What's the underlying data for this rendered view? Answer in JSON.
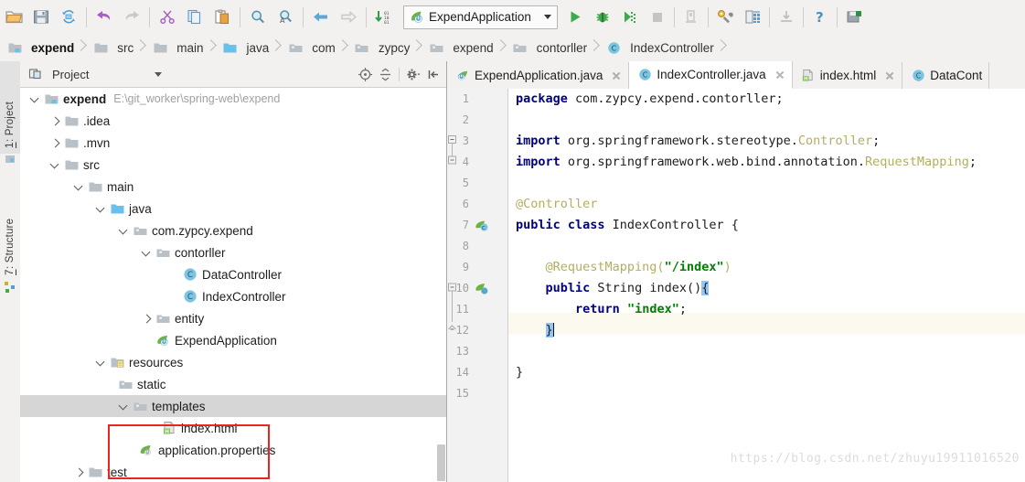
{
  "toolbar": {
    "buttons": [
      {
        "name": "open-folder-icon",
        "label": "Open"
      },
      {
        "name": "save-all-icon",
        "label": "Save All"
      },
      {
        "name": "synchronize-icon",
        "label": "Synchronize"
      },
      {
        "name": "undo-icon",
        "label": "Undo"
      },
      {
        "name": "redo-icon",
        "label": "Redo"
      },
      {
        "name": "cut-icon",
        "label": "Cut"
      },
      {
        "name": "copy-icon",
        "label": "Copy"
      },
      {
        "name": "paste-icon",
        "label": "Paste"
      },
      {
        "name": "find-icon",
        "label": "Find"
      },
      {
        "name": "replace-icon",
        "label": "Replace"
      },
      {
        "name": "back-icon",
        "label": "Back"
      },
      {
        "name": "forward-icon",
        "label": "Forward"
      },
      {
        "name": "compile-icon",
        "label": "Compile"
      }
    ],
    "run_config": {
      "name": "ExpendApplication",
      "icon": "spring-boot-icon"
    },
    "run_buttons": [
      {
        "name": "run-icon",
        "label": "Run"
      },
      {
        "name": "debug-icon",
        "label": "Debug"
      },
      {
        "name": "run-with-coverage-icon",
        "label": "Run with Coverage"
      },
      {
        "name": "stop-icon",
        "label": "Stop"
      },
      {
        "name": "update-application-icon",
        "label": "Update Application"
      },
      {
        "name": "settings-wrench-icon",
        "label": "Project Structure"
      },
      {
        "name": "database-icon",
        "label": "Database"
      },
      {
        "name": "import-icon",
        "label": "Import"
      },
      {
        "name": "help-icon",
        "label": "Help"
      },
      {
        "name": "maven-icon",
        "label": "Maven"
      }
    ]
  },
  "breadcrumb": [
    {
      "label": "expend",
      "icon": "module-folder-icon",
      "root": true
    },
    {
      "label": "src",
      "icon": "folder-icon",
      "root": false
    },
    {
      "label": "main",
      "icon": "folder-icon",
      "root": false
    },
    {
      "label": "java",
      "icon": "source-folder-icon",
      "root": false
    },
    {
      "label": "com",
      "icon": "package-icon",
      "root": false
    },
    {
      "label": "zypcy",
      "icon": "package-icon",
      "root": false
    },
    {
      "label": "expend",
      "icon": "package-icon",
      "root": false
    },
    {
      "label": "contorller",
      "icon": "package-icon",
      "root": false
    },
    {
      "label": "IndexController",
      "icon": "class-icon",
      "root": false
    }
  ],
  "tool_window_tabs": [
    {
      "num": "1",
      "label": ": Project",
      "active": true,
      "icon": "project-icon"
    },
    {
      "num": "7",
      "label": ": Structure",
      "active": false,
      "icon": "structure-icon"
    }
  ],
  "project_panel": {
    "title": "Project",
    "tools": [
      {
        "name": "scroll-from-source-icon"
      },
      {
        "name": "collapse-all-icon"
      },
      {
        "name": "settings-gear-icon"
      },
      {
        "name": "hide-panel-icon"
      }
    ],
    "tree": [
      {
        "depth": 0,
        "twisty": "open",
        "icon": "module-folder-icon",
        "label": "expend",
        "bold": true,
        "path": "E:\\git_worker\\spring-web\\expend",
        "selected": false
      },
      {
        "depth": 1,
        "twisty": "closed",
        "icon": "folder-icon",
        "label": ".idea",
        "bold": false,
        "path": "",
        "selected": false
      },
      {
        "depth": 1,
        "twisty": "closed",
        "icon": "folder-icon",
        "label": ".mvn",
        "bold": false,
        "path": "",
        "selected": false
      },
      {
        "depth": 1,
        "twisty": "open",
        "icon": "folder-icon",
        "label": "src",
        "bold": false,
        "path": "",
        "selected": false
      },
      {
        "depth": 2,
        "twisty": "open",
        "icon": "folder-icon",
        "label": "main",
        "bold": false,
        "path": "",
        "selected": false
      },
      {
        "depth": 3,
        "twisty": "open",
        "icon": "source-folder-icon",
        "label": "java",
        "bold": false,
        "path": "",
        "selected": false
      },
      {
        "depth": 4,
        "twisty": "open",
        "icon": "package-icon",
        "label": "com.zypcy.expend",
        "bold": false,
        "path": "",
        "selected": false
      },
      {
        "depth": 5,
        "twisty": "open",
        "icon": "package-icon",
        "label": "contorller",
        "bold": false,
        "path": "",
        "selected": false
      },
      {
        "depth": 6,
        "twisty": "none",
        "icon": "class-icon",
        "label": "DataController",
        "bold": false,
        "path": "",
        "selected": false
      },
      {
        "depth": 6,
        "twisty": "none",
        "icon": "class-icon",
        "label": "IndexController",
        "bold": false,
        "path": "",
        "selected": false
      },
      {
        "depth": 5,
        "twisty": "closed",
        "icon": "package-icon",
        "label": "entity",
        "bold": false,
        "path": "",
        "selected": false
      },
      {
        "depth": 5,
        "twisty": "none",
        "icon": "spring-boot-icon",
        "label": "ExpendApplication",
        "bold": false,
        "path": "",
        "selected": false
      },
      {
        "depth": 3,
        "twisty": "open",
        "icon": "resources-folder-icon",
        "label": "resources",
        "bold": false,
        "path": "",
        "selected": false
      },
      {
        "depth": 4,
        "twisty": "none",
        "icon": "package-icon",
        "label": "static",
        "bold": false,
        "path": "",
        "selected": false
      },
      {
        "depth": 4,
        "twisty": "open",
        "icon": "package-icon",
        "label": "templates",
        "bold": false,
        "path": "",
        "selected": true
      },
      {
        "depth": 5,
        "twisty": "none",
        "icon": "html-file-icon",
        "label": "index.html",
        "bold": false,
        "path": "",
        "selected": false
      },
      {
        "depth": 4,
        "twisty": "none",
        "icon": "spring-properties-icon",
        "label": "application.properties",
        "bold": false,
        "path": "",
        "selected": false
      },
      {
        "depth": 2,
        "twisty": "closed",
        "icon": "folder-icon",
        "label": "test",
        "bold": false,
        "path": "",
        "selected": false
      }
    ],
    "annotation_color": "#e8251f"
  },
  "editor": {
    "tabs": [
      {
        "label": "ExpendApplication.java",
        "icon": "spring-boot-icon",
        "active": false
      },
      {
        "label": "IndexController.java",
        "icon": "class-icon",
        "active": true
      },
      {
        "label": "index.html",
        "icon": "html-file-icon",
        "active": false
      },
      {
        "label": "DataCont",
        "icon": "class-icon",
        "active": false
      }
    ],
    "line_numbers": [
      "1",
      "2",
      "3",
      "4",
      "5",
      "6",
      "7",
      "8",
      "9",
      "10",
      "11",
      "12",
      "13",
      "14",
      "15"
    ],
    "current_line": 12,
    "caret_line": 12,
    "watermark": "https://blog.csdn.net/zhuyu19911016520",
    "code": [
      {
        "n": 1,
        "text": "package com.zypcy.expend.contorller;"
      },
      {
        "n": 2,
        "text": ""
      },
      {
        "n": 3,
        "text": "import org.springframework.stereotype.Controller;"
      },
      {
        "n": 4,
        "text": "import org.springframework.web.bind.annotation.RequestMapping;"
      },
      {
        "n": 5,
        "text": ""
      },
      {
        "n": 6,
        "text": "@Controller"
      },
      {
        "n": 7,
        "text": "public class IndexController {"
      },
      {
        "n": 8,
        "text": ""
      },
      {
        "n": 9,
        "text": "    @RequestMapping(\"/index\")"
      },
      {
        "n": 10,
        "text": "    public String index() {"
      },
      {
        "n": 11,
        "text": "        return \"index\";"
      },
      {
        "n": 12,
        "text": "    }"
      },
      {
        "n": 13,
        "text": ""
      },
      {
        "n": 14,
        "text": "}"
      },
      {
        "n": 15,
        "text": ""
      }
    ]
  }
}
